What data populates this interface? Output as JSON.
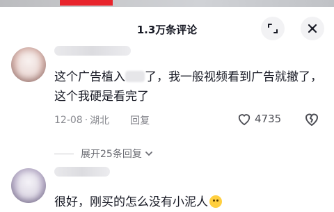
{
  "header": {
    "title": "1.3万条评论"
  },
  "comments": [
    {
      "text": "这个广告植入",
      "text_after_blur": "了，我一般视频看到广告就撤了，这个我硬是看完了",
      "date": "12-08",
      "location": "湖北",
      "reply_label": "回复",
      "like_count": "4735",
      "expand_label": "展开25条回复"
    },
    {
      "text": "很好，刚买的怎么没有小泥人",
      "emoji": "crying-face"
    }
  ],
  "colors": {
    "accent_red": "#e8242c",
    "text_primary": "#161823",
    "text_secondary": "#8a8b91"
  }
}
